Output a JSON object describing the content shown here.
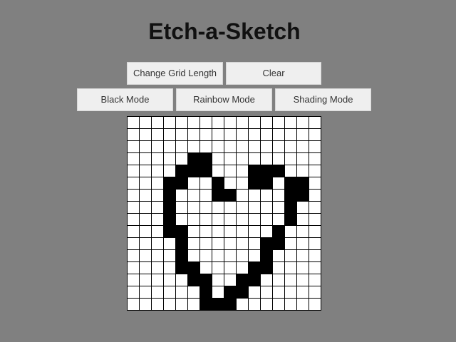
{
  "title": "Etch-a-Sketch",
  "controls": {
    "change_grid_length": "Change Grid Length",
    "clear": "Clear",
    "black_mode": "Black Mode",
    "rainbow_mode": "Rainbow Mode",
    "shading_mode": "Shading Mode"
  },
  "colors": {
    "background": "#808080",
    "cell_empty": "#ffffff",
    "cell_filled": "#000000",
    "button_bg": "#efefef"
  },
  "grid": {
    "size": 16,
    "rows": [
      "0000000000000000",
      "0000000000000000",
      "0000000000000000",
      "0000011000000000",
      "0000111000111000",
      "0001100100110110",
      "0001000110000110",
      "0001000000000100",
      "0001000000000100",
      "0001100000001000",
      "0000100000011000",
      "0000100000010000",
      "0000110000110000",
      "0000011001100000",
      "0000001011000000",
      "0000001110000000"
    ]
  }
}
